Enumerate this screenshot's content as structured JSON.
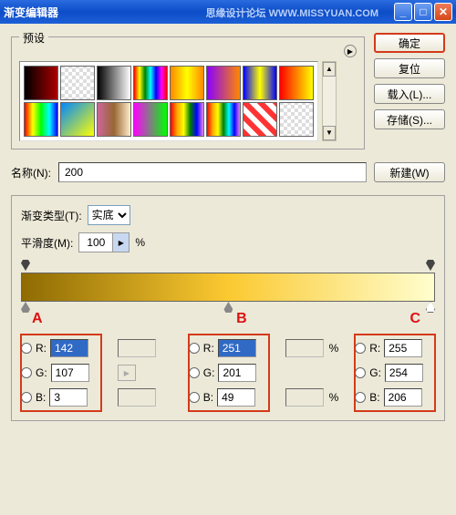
{
  "title": "渐变编辑器",
  "watermark": "思缘设计论坛  WWW.MISSYUAN.COM",
  "presets_label": "预设",
  "buttons": {
    "ok": "确定",
    "reset": "复位",
    "load": "载入(L)...",
    "save": "存储(S)...",
    "new": "新建(W)"
  },
  "name_label": "名称(N):",
  "name_value": "200",
  "type_label": "渐变类型(T):",
  "type_value": "实底",
  "smooth_label": "平滑度(M):",
  "smooth_value": "100",
  "percent": "%",
  "markers": {
    "a": "A",
    "b": "B",
    "c": "C"
  },
  "rgb_labels": {
    "r": "R:",
    "g": "G:",
    "b": "B:"
  },
  "stops": {
    "a": {
      "r": "142",
      "g": "107",
      "b": "3"
    },
    "b": {
      "r": "251",
      "g": "201",
      "b": "49"
    },
    "c": {
      "r": "255",
      "g": "254",
      "b": "206"
    }
  }
}
